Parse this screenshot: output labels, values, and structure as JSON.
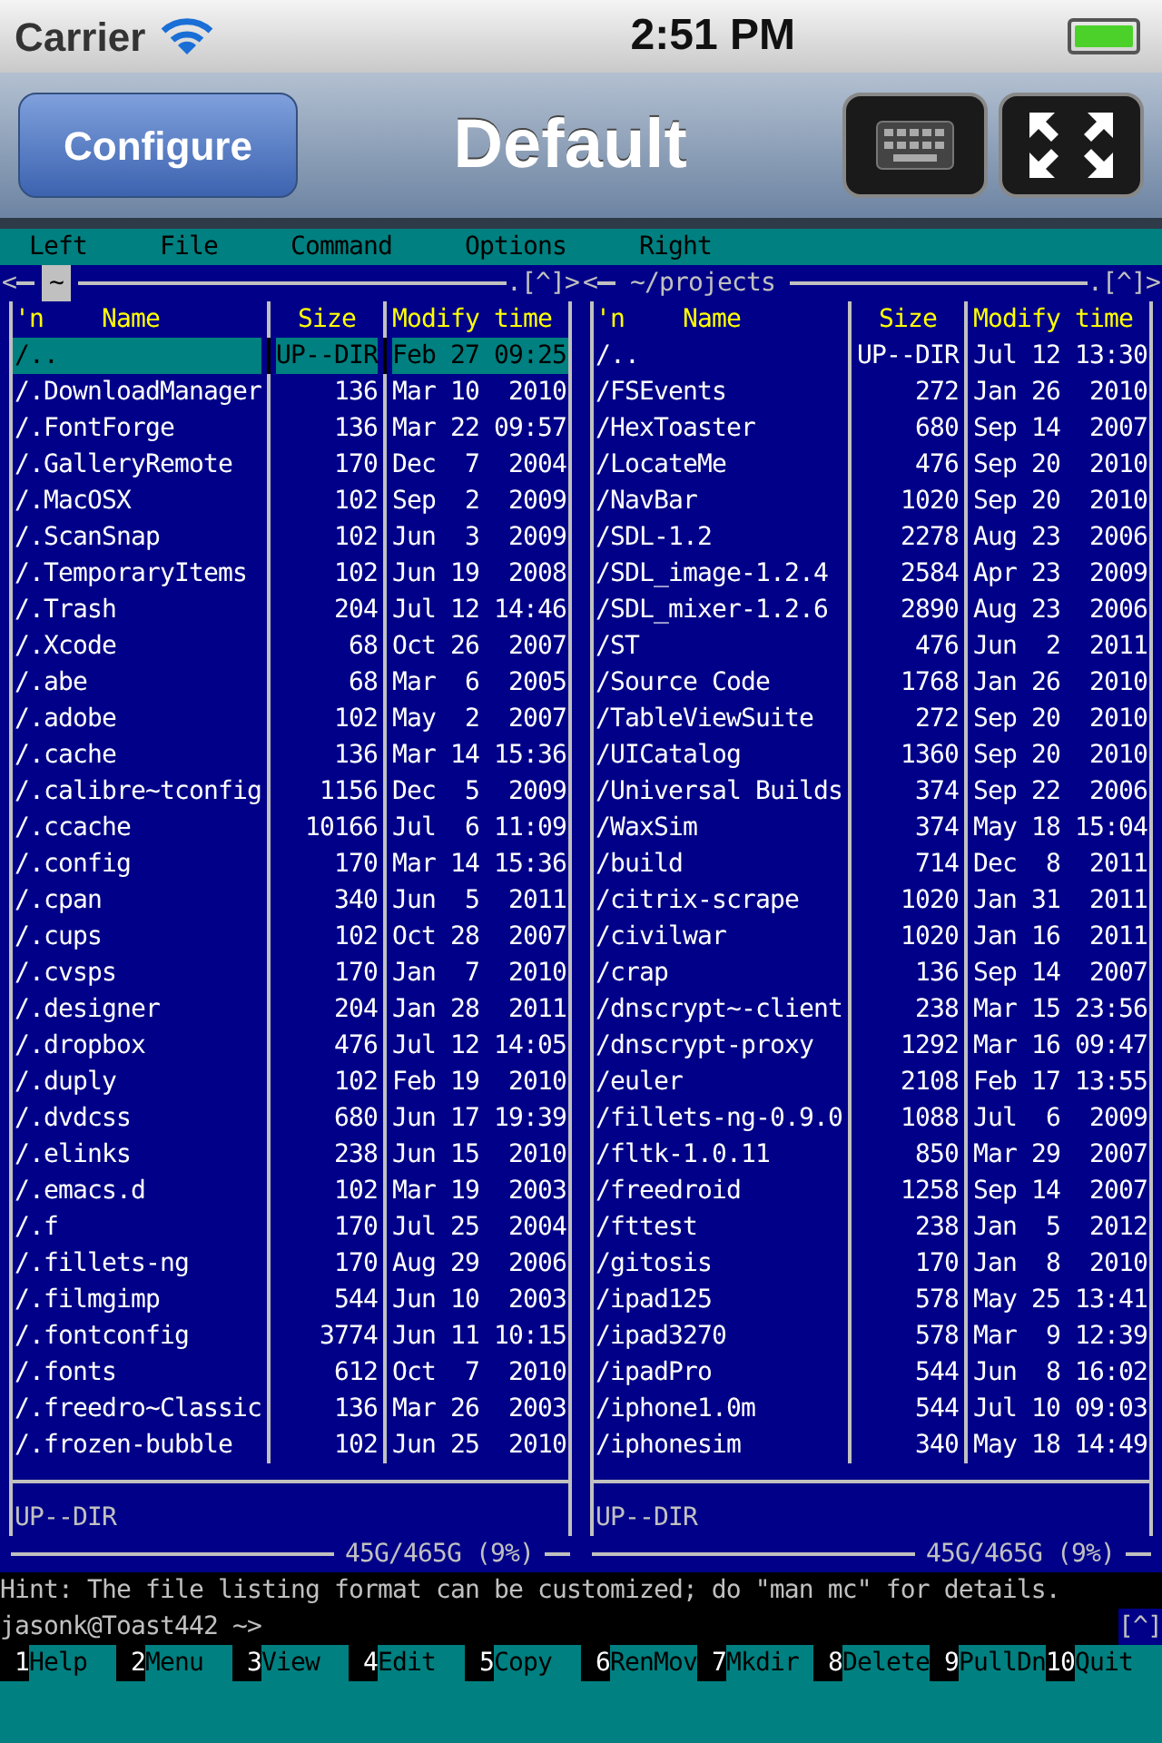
{
  "status_bar": {
    "carrier": "Carrier",
    "time": "2:51 PM"
  },
  "nav_bar": {
    "left_button": "Configure",
    "title": "Default"
  },
  "menu_bar": [
    "Left",
    "File",
    "Command",
    "Options",
    "Right"
  ],
  "panels": [
    {
      "left_marker": "<",
      "title": "~",
      "active": true,
      "right_marker": ".[^]>",
      "columns": [
        "'n",
        "Name",
        "Size",
        "Modify time"
      ],
      "rows": [
        {
          "name": "/..",
          "size": "UP--DIR",
          "modified": "Feb 27 09:25",
          "selected": true
        },
        {
          "name": "/.DownloadManager",
          "size": "136",
          "modified": "Mar 10  2010",
          "selected": false
        },
        {
          "name": "/.FontForge",
          "size": "136",
          "modified": "Mar 22 09:57",
          "selected": false
        },
        {
          "name": "/.GalleryRemote",
          "size": "170",
          "modified": "Dec  7  2004",
          "selected": false
        },
        {
          "name": "/.MacOSX",
          "size": "102",
          "modified": "Sep  2  2009",
          "selected": false
        },
        {
          "name": "/.ScanSnap",
          "size": "102",
          "modified": "Jun  3  2009",
          "selected": false
        },
        {
          "name": "/.TemporaryItems",
          "size": "102",
          "modified": "Jun 19  2008",
          "selected": false
        },
        {
          "name": "/.Trash",
          "size": "204",
          "modified": "Jul 12 14:46",
          "selected": false
        },
        {
          "name": "/.Xcode",
          "size": "68",
          "modified": "Oct 26  2007",
          "selected": false
        },
        {
          "name": "/.abe",
          "size": "68",
          "modified": "Mar  6  2005",
          "selected": false
        },
        {
          "name": "/.adobe",
          "size": "102",
          "modified": "May  2  2007",
          "selected": false
        },
        {
          "name": "/.cache",
          "size": "136",
          "modified": "Mar 14 15:36",
          "selected": false
        },
        {
          "name": "/.calibre~tconfig",
          "size": "1156",
          "modified": "Dec  5  2009",
          "selected": false
        },
        {
          "name": "/.ccache",
          "size": "10166",
          "modified": "Jul  6 11:09",
          "selected": false
        },
        {
          "name": "/.config",
          "size": "170",
          "modified": "Mar 14 15:36",
          "selected": false
        },
        {
          "name": "/.cpan",
          "size": "340",
          "modified": "Jun  5  2011",
          "selected": false
        },
        {
          "name": "/.cups",
          "size": "102",
          "modified": "Oct 28  2007",
          "selected": false
        },
        {
          "name": "/.cvsps",
          "size": "170",
          "modified": "Jan  7  2010",
          "selected": false
        },
        {
          "name": "/.designer",
          "size": "204",
          "modified": "Jan 28  2011",
          "selected": false
        },
        {
          "name": "/.dropbox",
          "size": "476",
          "modified": "Jul 12 14:05",
          "selected": false
        },
        {
          "name": "/.duply",
          "size": "102",
          "modified": "Feb 19  2010",
          "selected": false
        },
        {
          "name": "/.dvdcss",
          "size": "680",
          "modified": "Jun 17 19:39",
          "selected": false
        },
        {
          "name": "/.elinks",
          "size": "238",
          "modified": "Jun 15  2010",
          "selected": false
        },
        {
          "name": "/.emacs.d",
          "size": "102",
          "modified": "Mar 19  2003",
          "selected": false
        },
        {
          "name": "/.f",
          "size": "170",
          "modified": "Jul 25  2004",
          "selected": false
        },
        {
          "name": "/.fillets-ng",
          "size": "170",
          "modified": "Aug 29  2006",
          "selected": false
        },
        {
          "name": "/.filmgimp",
          "size": "544",
          "modified": "Jun 10  2003",
          "selected": false
        },
        {
          "name": "/.fontconfig",
          "size": "3774",
          "modified": "Jun 11 10:15",
          "selected": false
        },
        {
          "name": "/.fonts",
          "size": "612",
          "modified": "Oct  7  2010",
          "selected": false
        },
        {
          "name": "/.freedro~Classic",
          "size": "136",
          "modified": "Mar 26  2003",
          "selected": false
        },
        {
          "name": "/.frozen-bubble",
          "size": "102",
          "modified": "Jun 25  2010",
          "selected": false
        }
      ],
      "mini_status": "UP--DIR",
      "disk_usage": "45G/465G (9%)"
    },
    {
      "left_marker": "<",
      "title": "~/projects",
      "active": false,
      "right_marker": ".[^]>",
      "columns": [
        "'n",
        "Name",
        "Size",
        "Modify time"
      ],
      "rows": [
        {
          "name": "/..",
          "size": "UP--DIR",
          "modified": "Jul 12 13:30",
          "selected": false
        },
        {
          "name": "/FSEvents",
          "size": "272",
          "modified": "Jan 26  2010",
          "selected": false
        },
        {
          "name": "/HexToaster",
          "size": "680",
          "modified": "Sep 14  2007",
          "selected": false
        },
        {
          "name": "/LocateMe",
          "size": "476",
          "modified": "Sep 20  2010",
          "selected": false
        },
        {
          "name": "/NavBar",
          "size": "1020",
          "modified": "Sep 20  2010",
          "selected": false
        },
        {
          "name": "/SDL-1.2",
          "size": "2278",
          "modified": "Aug 23  2006",
          "selected": false
        },
        {
          "name": "/SDL_image-1.2.4",
          "size": "2584",
          "modified": "Apr 23  2009",
          "selected": false
        },
        {
          "name": "/SDL_mixer-1.2.6",
          "size": "2890",
          "modified": "Aug 23  2006",
          "selected": false
        },
        {
          "name": "/ST",
          "size": "476",
          "modified": "Jun  2  2011",
          "selected": false
        },
        {
          "name": "/Source Code",
          "size": "1768",
          "modified": "Jan 26  2010",
          "selected": false
        },
        {
          "name": "/TableViewSuite",
          "size": "272",
          "modified": "Sep 20  2010",
          "selected": false
        },
        {
          "name": "/UICatalog",
          "size": "1360",
          "modified": "Sep 20  2010",
          "selected": false
        },
        {
          "name": "/Universal Builds",
          "size": "374",
          "modified": "Sep 22  2006",
          "selected": false
        },
        {
          "name": "/WaxSim",
          "size": "374",
          "modified": "May 18 15:04",
          "selected": false
        },
        {
          "name": "/build",
          "size": "714",
          "modified": "Dec  8  2011",
          "selected": false
        },
        {
          "name": "/citrix-scrape",
          "size": "1020",
          "modified": "Jan 31  2011",
          "selected": false
        },
        {
          "name": "/civilwar",
          "size": "1020",
          "modified": "Jan 16  2011",
          "selected": false
        },
        {
          "name": "/crap",
          "size": "136",
          "modified": "Sep 14  2007",
          "selected": false
        },
        {
          "name": "/dnscrypt~-client",
          "size": "238",
          "modified": "Mar 15 23:56",
          "selected": false
        },
        {
          "name": "/dnscrypt-proxy",
          "size": "1292",
          "modified": "Mar 16 09:47",
          "selected": false
        },
        {
          "name": "/euler",
          "size": "2108",
          "modified": "Feb 17 13:55",
          "selected": false
        },
        {
          "name": "/fillets-ng-0.9.0",
          "size": "1088",
          "modified": "Jul  6  2009",
          "selected": false
        },
        {
          "name": "/fltk-1.0.11",
          "size": "850",
          "modified": "Mar 29  2007",
          "selected": false
        },
        {
          "name": "/freedroid",
          "size": "1258",
          "modified": "Sep 14  2007",
          "selected": false
        },
        {
          "name": "/fttest",
          "size": "238",
          "modified": "Jan  5  2012",
          "selected": false
        },
        {
          "name": "/gitosis",
          "size": "170",
          "modified": "Jan  8  2010",
          "selected": false
        },
        {
          "name": "/ipad125",
          "size": "578",
          "modified": "May 25 13:41",
          "selected": false
        },
        {
          "name": "/ipad3270",
          "size": "578",
          "modified": "Mar  9 12:39",
          "selected": false
        },
        {
          "name": "/ipadPro",
          "size": "544",
          "modified": "Jun  8 16:02",
          "selected": false
        },
        {
          "name": "/iphone1.0m",
          "size": "544",
          "modified": "Jul 10 09:03",
          "selected": false
        },
        {
          "name": "/iphonesim",
          "size": "340",
          "modified": "May 18 14:49",
          "selected": false
        }
      ],
      "mini_status": "UP--DIR",
      "disk_usage": "45G/465G (9%)"
    }
  ],
  "hint": "Hint: The file listing format can be customized; do \"man mc\" for details.",
  "prompt": "jasonk@Toast442 ~>",
  "prompt_marker": "[^]",
  "function_keys": [
    {
      "number": "1",
      "label": "Help"
    },
    {
      "number": "2",
      "label": "Menu"
    },
    {
      "number": "3",
      "label": "View"
    },
    {
      "number": "4",
      "label": "Edit"
    },
    {
      "number": "5",
      "label": "Copy"
    },
    {
      "number": "6",
      "label": "RenMov"
    },
    {
      "number": "7",
      "label": "Mkdir"
    },
    {
      "number": "8",
      "label": "Delete"
    },
    {
      "number": "9",
      "label": "PullDn"
    },
    {
      "number": "10",
      "label": "Quit"
    }
  ]
}
